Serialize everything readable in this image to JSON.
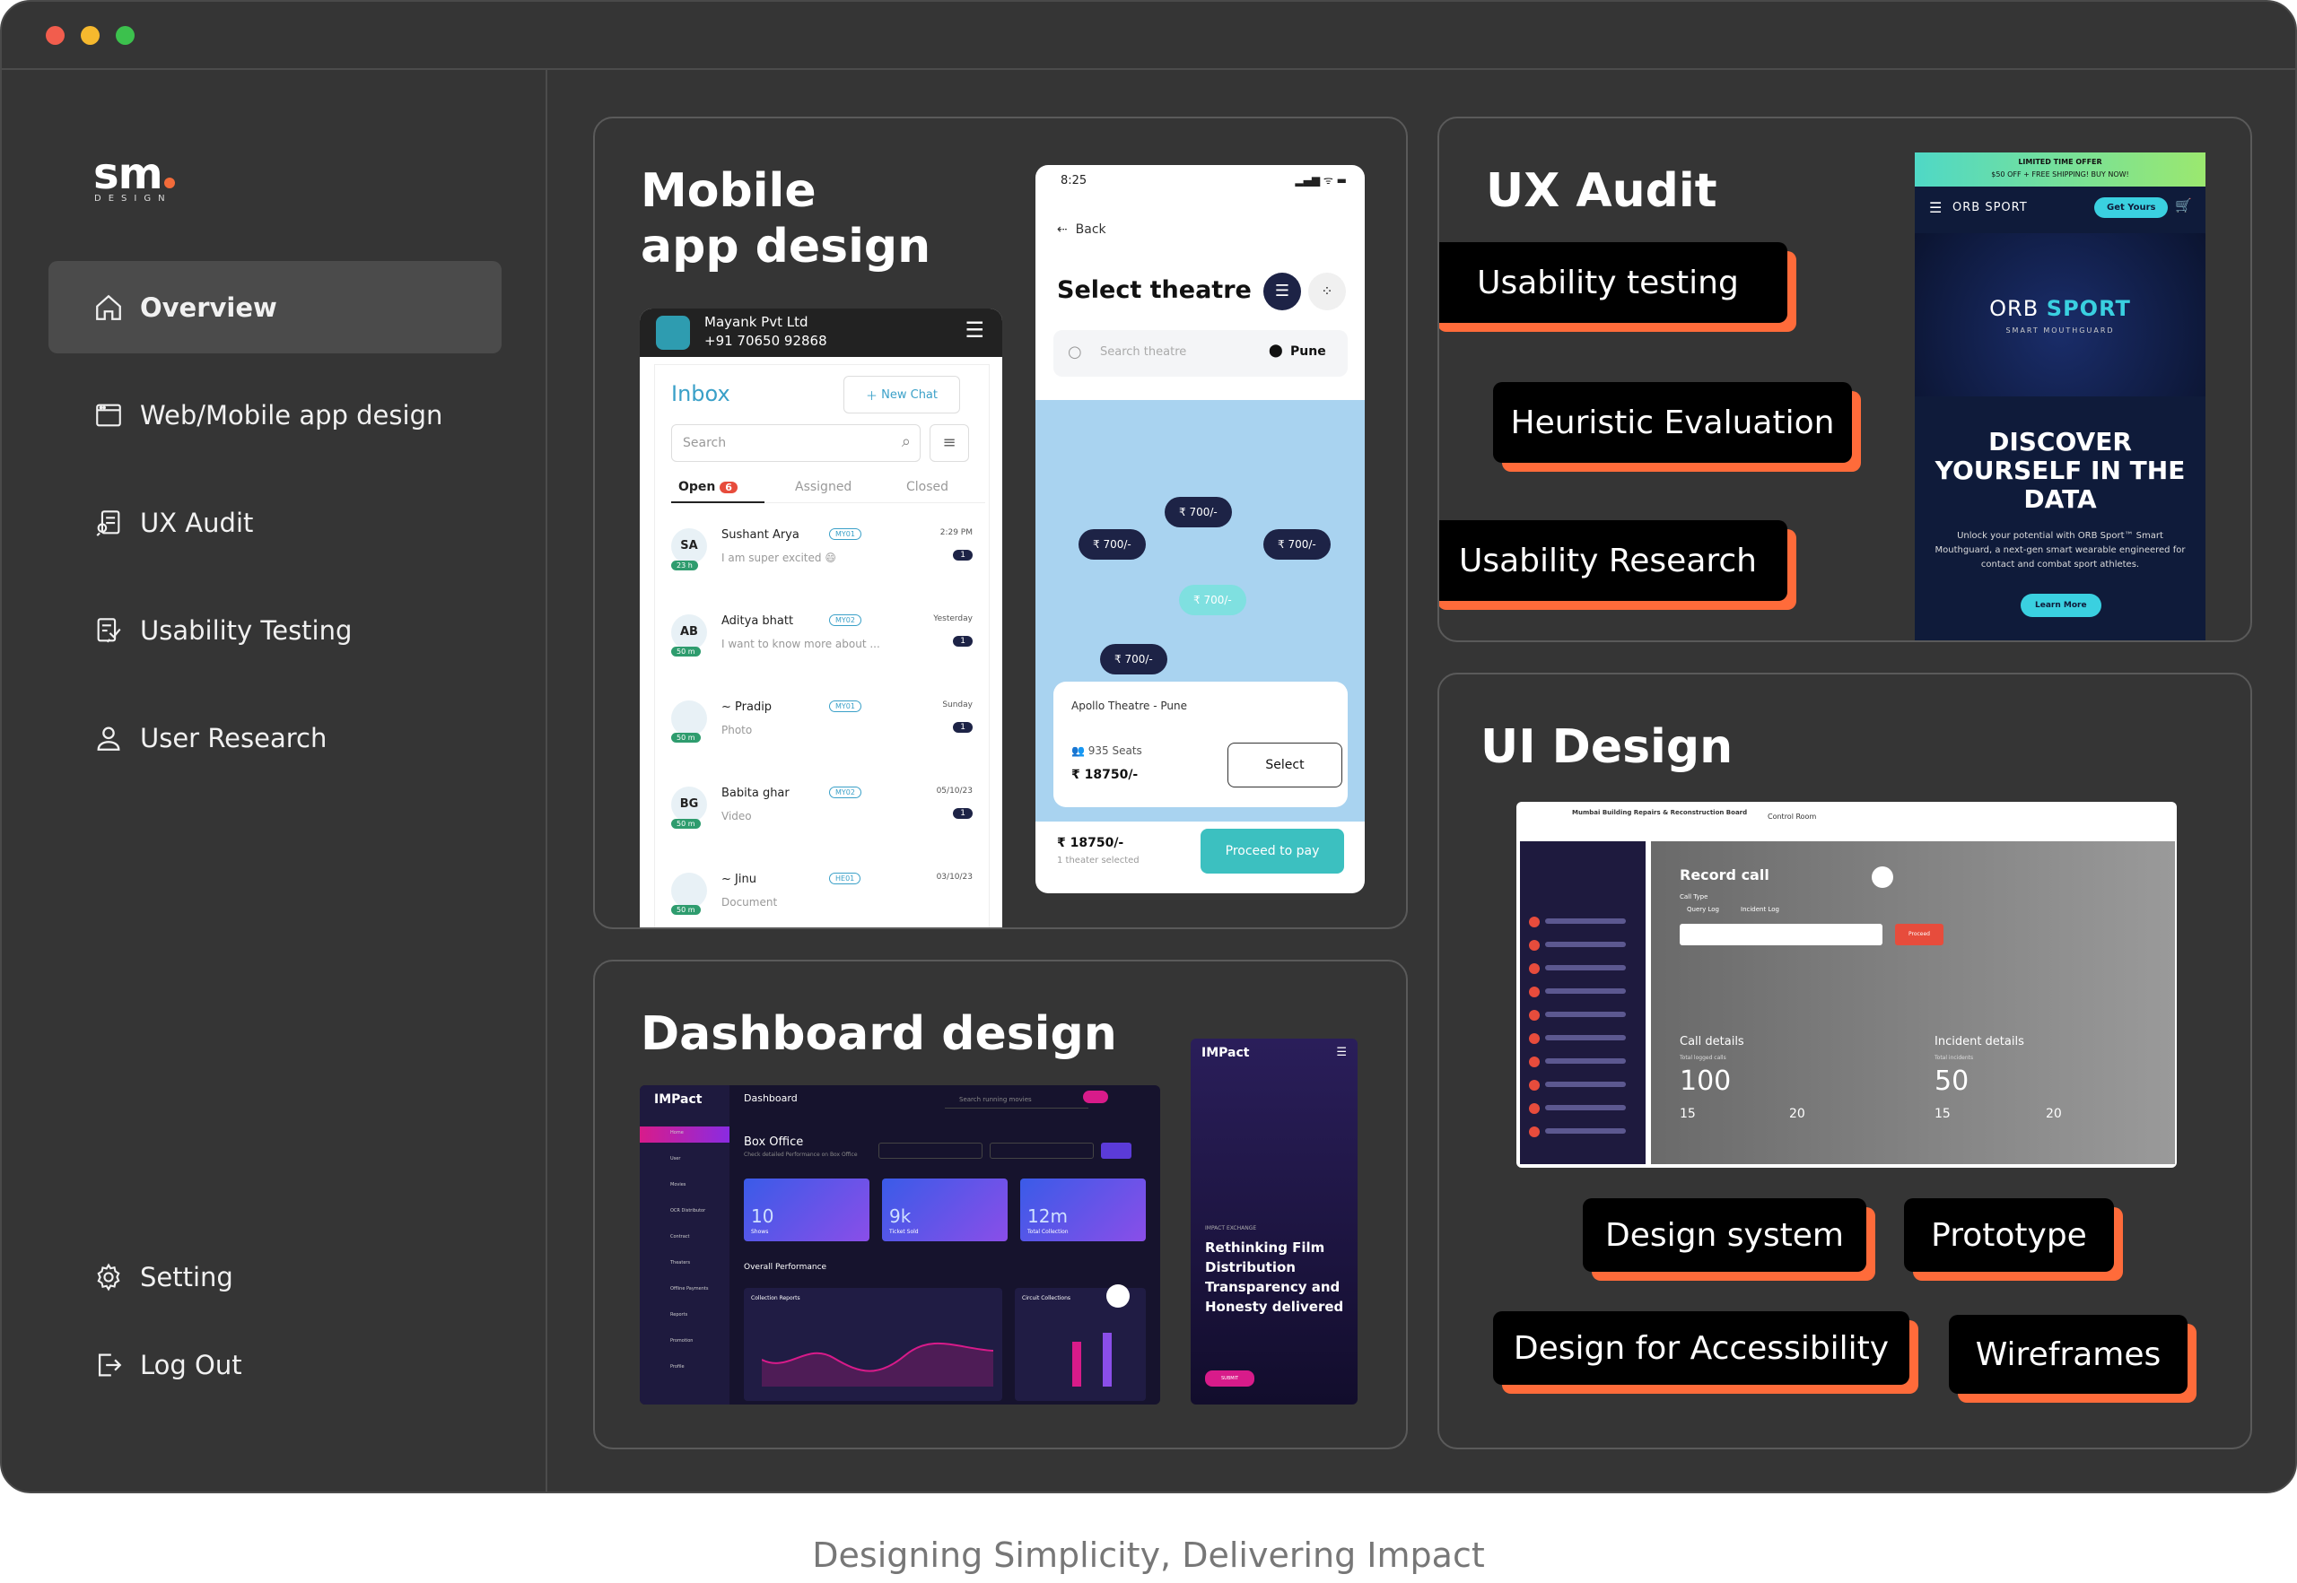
{
  "tagline": "Designing Simplicity, Delivering Impact",
  "brand": {
    "logo": "sm",
    "sub": "DESIGN",
    "accent": "#f26b3a"
  },
  "sidebar": {
    "items": [
      {
        "label": "Overview",
        "icon": "home-icon"
      },
      {
        "label": "Web/Mobile app design",
        "icon": "browser-window-icon"
      },
      {
        "label": "UX Audit",
        "icon": "audit-icon"
      },
      {
        "label": "Usability Testing",
        "icon": "testing-icon"
      },
      {
        "label": "User Research",
        "icon": "user-icon"
      }
    ],
    "bottom": [
      {
        "label": "Setting",
        "icon": "gear-icon"
      },
      {
        "label": "Log Out",
        "icon": "logout-icon"
      }
    ]
  },
  "mobile_card": {
    "title_line1": "Mobile",
    "title_line2": "app design",
    "inbox_app": {
      "company": "Mayank Pvt Ltd",
      "phone": "+91 70650 92868",
      "title": "Inbox",
      "new_chat": "New Chat",
      "search_placeholder": "Search",
      "tabs": [
        "Open",
        "Assigned",
        "Closed"
      ],
      "open_count": "6",
      "chats": [
        {
          "initials": "SA",
          "badge": "23 h",
          "name": "Sushant Arya",
          "tag": "MY01",
          "msg": "I am super excited 😄",
          "time": "2:29 PM",
          "count": "1"
        },
        {
          "initials": "AB",
          "badge": "50 m",
          "name": "Aditya bhatt",
          "tag": "MY02",
          "msg": "I want to know more about ...",
          "time": "Yesterday",
          "count": "1"
        },
        {
          "initials": "",
          "badge": "50 m",
          "name": "~ Pradip",
          "tag": "MY01",
          "msg": "Photo",
          "time": "Sunday",
          "count": "1"
        },
        {
          "initials": "BG",
          "badge": "50 m",
          "name": "Babita ghar",
          "tag": "MY02",
          "msg": "Video",
          "time": "05/10/23",
          "count": "1"
        },
        {
          "initials": "",
          "badge": "50 m",
          "name": "~ Jinu",
          "tag": "HE01",
          "msg": "Document",
          "time": "03/10/23",
          "count": ""
        }
      ]
    },
    "theatre_app": {
      "time": "8:25",
      "back": "Back",
      "title": "Select theatre",
      "search_placeholder": "Search theatre",
      "city": "Pune",
      "pins": [
        "₹ 700/-",
        "₹ 700/-",
        "₹ 700/-",
        "₹ 700/-",
        "₹ 700/-"
      ],
      "theatre_name": "Apollo Theatre - Pune",
      "seats": "935 Seats",
      "price": "₹ 18750/-",
      "select": "Select",
      "total": "₹ 18750/-",
      "selected_note": "1 theater selected",
      "proceed": "Proceed to pay"
    }
  },
  "ux_card": {
    "title": "UX Audit",
    "tags": [
      "Usability testing",
      "Heuristic Evaluation",
      "Usability Research"
    ],
    "orb": {
      "offer_line1": "LIMITED TIME OFFER",
      "offer_line2": "$50 OFF + FREE SHIPPING! BUY NOW!",
      "brand": "ORB SPORT",
      "cta": "Get Yours",
      "hero_brand_a": "ORB",
      "hero_brand_b": "SPORT",
      "hero_sub": "SMART MOUTHGUARD",
      "headline_1": "DISCOVER",
      "headline_2": "YOURSELF IN THE",
      "headline_3": "DATA",
      "body": "Unlock your potential with ORB Sport™ Smart Mouthguard, a next-gen smart wearable engineered for contact and combat sport athletes.",
      "learn": "Learn More"
    }
  },
  "dashboard_card": {
    "title": "Dashboard design",
    "dash": {
      "brand": "IMPact",
      "page": "Dashboard",
      "search": "Search running movies",
      "section": "Box Office",
      "section_sub": "Check detailed Performance on Box Office",
      "tiles": [
        {
          "v": "10",
          "l": "Shows"
        },
        {
          "v": "9k",
          "l": "Ticket Sold"
        },
        {
          "v": "12m",
          "l": "Total Collection"
        }
      ],
      "overall": "Overall Performance",
      "collection": "Collection Reports",
      "circuit": "Circuit Collections",
      "menu": [
        "Home",
        "User",
        "Movies",
        "OCR Distributor",
        "Contract",
        "Theaters",
        "Offline Payments",
        "Reports",
        "Promotion",
        "Profile"
      ]
    },
    "promo": {
      "brand": "IMPact",
      "kicker": "IMPACT EXCHANGE",
      "headline": "Rethinking Film Distribution Transparency and Honesty delivered",
      "cta": "SUBMIT"
    }
  },
  "ui_card": {
    "title": "UI Design",
    "screen": {
      "org": "Mumbai Building Repairs & Reconstruction Board",
      "section": "Control Room",
      "record": "Record call",
      "call_type": "Call Type",
      "opt1": "Query Log",
      "opt2": "Incident Log",
      "proceed": "Proceed",
      "call_details": "Call details",
      "total_calls_label": "Total logged calls",
      "total_calls": "100",
      "query_call": "15",
      "incident_call": "20",
      "incident_details": "Incident details",
      "total_inc_label": "Total incidents",
      "total_inc": "50",
      "open_inc": "15",
      "closed_inc": "20"
    },
    "tags": [
      "Design system",
      "Prototype",
      "Design for Accessibility",
      "Wireframes"
    ]
  }
}
